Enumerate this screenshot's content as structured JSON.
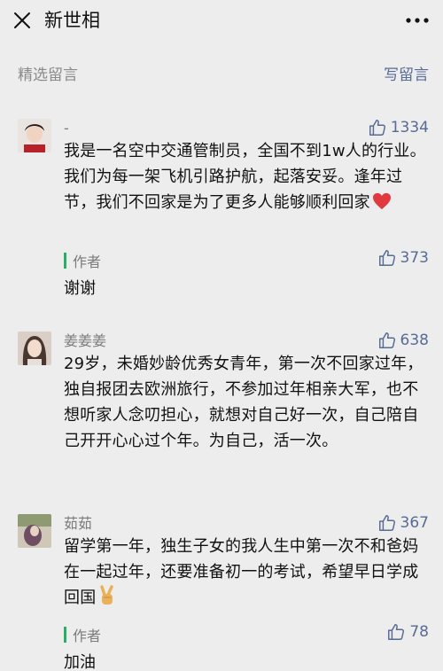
{
  "header": {
    "title": "新世相"
  },
  "section": {
    "label": "精选留言",
    "write_label": "写留言"
  },
  "comments": [
    {
      "nickname": "-",
      "likes": "1334",
      "content": "我是一名空中交通管制员，全国不到1w人的行业。我们为每一架飞机引路护航，起落安妥。逢年过节，我们不回家是为了更多人能够顺利回家",
      "emoji": "heart",
      "reply": {
        "author_label": "作者",
        "text": "谢谢",
        "likes": "373"
      }
    },
    {
      "nickname": "姜姜姜",
      "likes": "638",
      "content": "29岁，未婚妙龄优秀女青年，第一次不回家过年，独自报团去欧洲旅行，不参加过年相亲大军，也不想听家人念叨担心，就想对自己好一次，自己陪自己开开心心过个年。为自己，活一次。"
    },
    {
      "nickname": "茹茹",
      "likes": "367",
      "content": "留学第一年，独生子女的我人生中第一次不和爸妈在一起过年，还要准备初一的考试，希望早日学成回国",
      "emoji": "victory-hand",
      "reply": {
        "author_label": "作者",
        "text": "加油",
        "likes": "78"
      }
    }
  ],
  "colors": {
    "background": "#ededed",
    "link": "#576b95",
    "author_bar": "#2aae67",
    "heart": "#e0393e"
  }
}
